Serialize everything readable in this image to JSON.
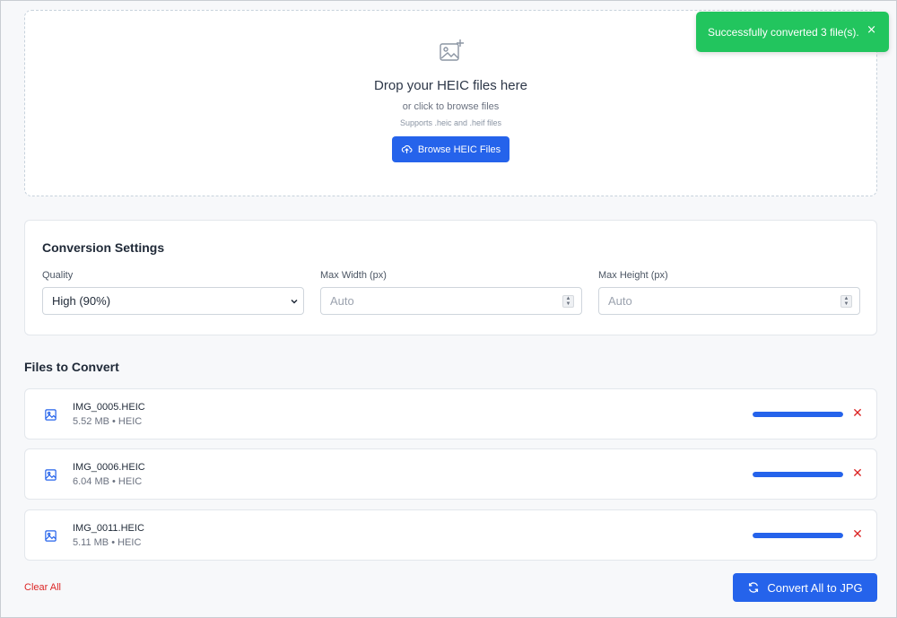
{
  "dropzone": {
    "title": "Drop your HEIC files here",
    "subtitle": "or click to browse files",
    "note": "Supports .heic and .heif files",
    "browse_label": "Browse HEIC Files",
    "icon": "image-add-icon"
  },
  "settings": {
    "title": "Conversion Settings",
    "quality": {
      "label": "Quality",
      "value": "High (90%)"
    },
    "max_width": {
      "label": "Max Width (px)",
      "placeholder": "Auto"
    },
    "max_height": {
      "label": "Max Height (px)",
      "placeholder": "Auto"
    }
  },
  "files": {
    "title": "Files to Convert",
    "items": [
      {
        "name": "IMG_0005.HEIC",
        "meta": "5.52 MB • HEIC",
        "progress": 1.0
      },
      {
        "name": "IMG_0006.HEIC",
        "meta": "6.04 MB • HEIC",
        "progress": 1.0
      },
      {
        "name": "IMG_0011.HEIC",
        "meta": "5.11 MB • HEIC",
        "progress": 1.0
      }
    ]
  },
  "actions": {
    "clear_all": "Clear All",
    "convert_all": "Convert All to JPG"
  },
  "toast": {
    "message": "Successfully converted 3 file(s).",
    "close": "×"
  },
  "colors": {
    "accent": "#2563eb",
    "success": "#22c55e",
    "danger": "#dc2626"
  }
}
